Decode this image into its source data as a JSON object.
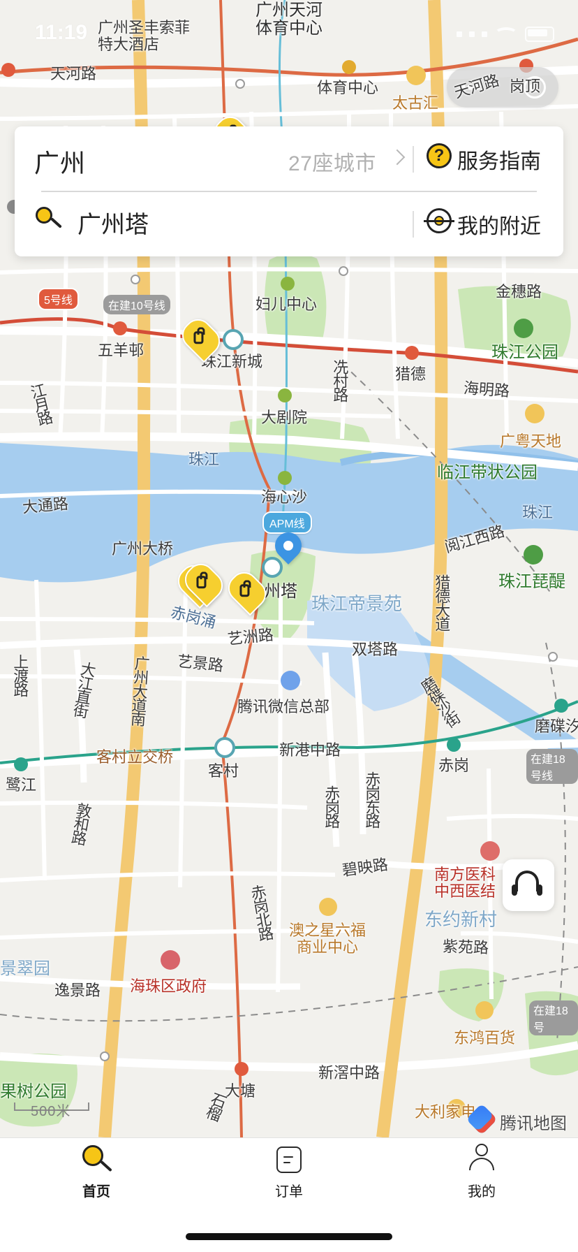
{
  "status_bar": {
    "time": "11:19"
  },
  "search_card": {
    "city": "广州",
    "city_count": "27座城市",
    "service_guide": "服务指南",
    "search_query": "广州塔",
    "nearby": "我的附近"
  },
  "mini_program": {
    "menu_dots": "•••"
  },
  "map": {
    "scale": "500米",
    "provider": "腾讯地图",
    "labels": {
      "guangzhou_sheraton": "广州圣丰索菲\n特大酒店",
      "tianhe_sports_center_top": "广州天河\n体育中心",
      "tianhe_road_left": "天河路",
      "sports_center": "体育中心",
      "taikoo_hui": "太古汇",
      "tianhe_road_right": "天河路",
      "gang_ding": "岗顶",
      "wuyang_village": "五羊邨",
      "zhujiang_new_town": "珠江新城",
      "women_children_center": "妇儿中心",
      "liede": "猎德",
      "zhujiang_park": "珠江公园",
      "jinsui_road": "金穗路",
      "haiming_road": "海明路",
      "guangyue_world": "广粤天地",
      "grand_theatre": "大剧院",
      "xiancun_road": "冼村路",
      "jiangyue_road": "江月路",
      "pearl_river_left": "珠江",
      "haixinsha": "海心沙",
      "apm_line": "APM线",
      "linjiang_park": "临江带状公园",
      "pearl_river_right": "珠江",
      "datong_road": "大通路",
      "yuejiang_west_road": "阅江西路",
      "pearl_river_pipa": "珠江琵醍",
      "guangzhou_bridge": "广州大桥",
      "canton_tower": "州塔",
      "zhujiang_dijingyuan": "珠江帝景苑",
      "chigang_chong": "赤岗涌",
      "yizhou_road": "艺洲路",
      "shuangta_road": "双塔路",
      "liede_avenue": "猎德大道",
      "shangdu_road": "上渡路",
      "dajiang_zhijie": "大江直街",
      "guangzhou_avenue_south": "广州大道南",
      "yijing_road": "艺景路",
      "tencent_hq": "腾讯微信总部",
      "modieshajie": "磨碟沙街",
      "modie": "磨碟汐",
      "kecun_interchange": "客村立交桥",
      "kecun": "客村",
      "xingang_middle_road": "新港中路",
      "chigang": "赤岗",
      "line18_construction": "在建18号线",
      "lujiang": "鹭江",
      "chigang_road": "赤岗路",
      "chigang_east_road": "赤岗东路",
      "dunhe_road": "敦和路",
      "biying_road": "碧映路",
      "southern_medical": "南方医科\n中西医结",
      "dongyue_new_village": "东约新村",
      "chigang_north_road": "赤岗北路",
      "aozhixing": "澳之星六福\n商业中心",
      "ziyuan_road": "紫苑路",
      "jingcuiyuan": "景翠园",
      "yijing_road_lower": "逸景路",
      "haizhu_gov": "海珠区政府",
      "line18_right": "在建18号",
      "donghong_department": "东鸿百货",
      "guoshu_park": "果树公园",
      "xinjiao_middle_road": "新滘中路",
      "datang": "大塘",
      "dali_home": "大利家电",
      "line5": "5号线",
      "line10_construction": "在建10号线",
      "shiliu": "石榴"
    }
  },
  "tabs": [
    {
      "label": "首页"
    },
    {
      "label": "订单"
    },
    {
      "label": "我的"
    }
  ]
}
